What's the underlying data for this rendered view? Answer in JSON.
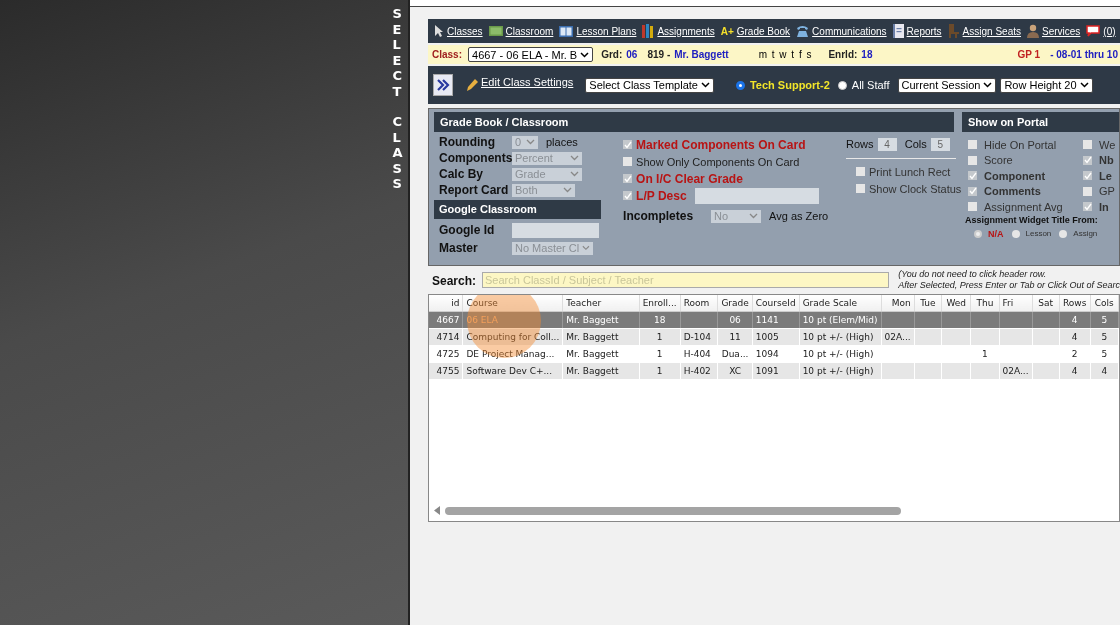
{
  "side_label": [
    "SELECT",
    "CLASS"
  ],
  "nav": [
    {
      "label": "Classes"
    },
    {
      "label": "Classroom"
    },
    {
      "label": "Lesson Plans"
    },
    {
      "label": "Assignments"
    },
    {
      "label": "Grade Book",
      "badge": "A+"
    },
    {
      "label": "Communications"
    },
    {
      "label": "Reports"
    },
    {
      "label": "Assign Seats"
    },
    {
      "label": "Services"
    },
    {
      "label": "(0)"
    }
  ],
  "class_bar": {
    "label": "Class:",
    "class_select": "4667 - 06 ELA - Mr. B",
    "grd_label": "Grd:",
    "grd": "06",
    "room": "819 -",
    "teacher": "Mr. Baggett",
    "days": "m t w t f s",
    "enrld_label": "Enrld:",
    "enrld": "18",
    "period": "GP 1",
    "dates": "- 08-01 thru 10"
  },
  "toolbar": {
    "edit_link": "Edit Class Settings",
    "template_select": "Select Class Template",
    "staff_options": [
      {
        "label": "Tech Support-2",
        "selected": true
      },
      {
        "label": "All Staff",
        "selected": false
      }
    ],
    "session_select": "Current Session",
    "row_height_select": "Row Height 20"
  },
  "gradebook": {
    "title": "Grade Book / Classroom",
    "fields": [
      {
        "label": "Rounding",
        "value": "0",
        "suffix": "places"
      },
      {
        "label": "Components",
        "value": "Percent"
      },
      {
        "label": "Calc By",
        "value": "Grade"
      },
      {
        "label": "Report Card",
        "value": "Both"
      }
    ],
    "google_title": "Google Classroom",
    "google_fields": [
      {
        "label": "Google Id",
        "kind": "input"
      },
      {
        "label": "Master",
        "kind": "select",
        "value": "No Master Cl"
      }
    ],
    "options": [
      {
        "label": "Marked Components On Card",
        "checked": true,
        "kind": "check"
      },
      {
        "label": "Show Only Components On Card",
        "checked": false,
        "kind": "check"
      },
      {
        "label": "On I/C Clear Grade",
        "checked": true,
        "kind": "check"
      },
      {
        "label": "L/P Desc",
        "checked": true,
        "kind": "check-input"
      }
    ],
    "incompletes": {
      "label": "Incompletes",
      "value": "No",
      "suffix": "Avg as Zero"
    },
    "rows_label": "Rows",
    "rows": "4",
    "cols_label": "Cols",
    "cols": "5",
    "print_options": [
      {
        "label": "Print Lunch Rect",
        "checked": false
      },
      {
        "label": "Show Clock Status",
        "checked": false
      }
    ]
  },
  "portal": {
    "title": "Show on Portal",
    "columns": [
      [
        {
          "label": "Hide On Portal",
          "checked": false
        },
        {
          "label": "Score",
          "checked": false
        },
        {
          "label": "Component",
          "checked": true
        },
        {
          "label": "Comments",
          "checked": true
        },
        {
          "label": "Assignment Avg",
          "checked": false
        }
      ],
      [
        {
          "label": "We",
          "checked": false
        },
        {
          "label": "Nb",
          "checked": true
        },
        {
          "label": "Le",
          "checked": true
        },
        {
          "label": "GP",
          "checked": false
        },
        {
          "label": "In",
          "checked": true
        }
      ]
    ],
    "widget_title": "Assignment Widget Title From:",
    "widget_options": [
      {
        "label": "N/A",
        "selected": true
      },
      {
        "label": "Lesson",
        "selected": false
      },
      {
        "label": "Assign",
        "selected": false
      }
    ]
  },
  "search": {
    "label": "Search:",
    "placeholder": "Search ClassId / Subject / Teacher",
    "note": [
      "(You do not need to click header row.",
      "After Selected, Press Enter or Tab or Click Out of Searc"
    ]
  },
  "table": {
    "columns": [
      "id",
      "Course",
      "Teacher",
      "Enroll...",
      "Room",
      "Grade",
      "CourseId",
      "Grade Scale",
      "Mon",
      "Tue",
      "Wed",
      "Thu",
      "Fri",
      "Sat",
      "Rows",
      "Cols"
    ],
    "rows": [
      {
        "selected": true,
        "cells": [
          "4667",
          "06 ELA",
          "Mr. Baggett",
          "18",
          "",
          "06",
          "1141",
          "10 pt (Elem/Mid)",
          "",
          "",
          "",
          "",
          "",
          "",
          "4",
          "5"
        ]
      },
      {
        "selected": false,
        "cells": [
          "4714",
          "Computing for Coll...",
          "Mr. Baggett",
          "1",
          "D-104",
          "11",
          "1005",
          "10 pt +/- (High)",
          "02A...",
          "",
          "",
          "",
          "",
          "",
          "4",
          "5"
        ]
      },
      {
        "selected": false,
        "cells": [
          "4725",
          "DE Project Manag...",
          "Mr. Baggett",
          "1",
          "H-404",
          "Dua...",
          "1094",
          "10 pt +/- (High)",
          "",
          "",
          "",
          "1",
          "",
          "",
          "2",
          "5"
        ]
      },
      {
        "selected": false,
        "cells": [
          "4755",
          "Software Dev C+...",
          "Mr. Baggett",
          "1",
          "H-402",
          "XC",
          "1091",
          "10 pt +/- (High)",
          "",
          "",
          "",
          "",
          "02A...",
          "",
          "4",
          "4"
        ]
      }
    ]
  }
}
